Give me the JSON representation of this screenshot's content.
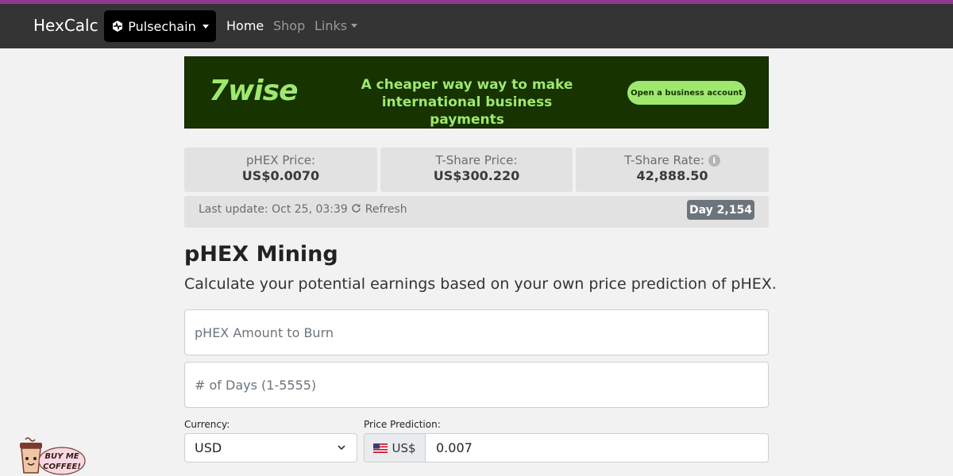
{
  "navbar": {
    "brand": "HexCalc",
    "chain_label": "Pulsechain",
    "home": "Home",
    "shop": "Shop",
    "links": "Links"
  },
  "banner": {
    "logo": "7wise",
    "text": "A cheaper way way to make international business payments",
    "cta": "Open a business account"
  },
  "stats": [
    {
      "label": "pHEX Price:",
      "value": "US$0.0070"
    },
    {
      "label": "T-Share Price:",
      "value": "US$300.220"
    },
    {
      "label": "T-Share Rate:",
      "value": "42,888.50"
    }
  ],
  "update": {
    "text": "Last update: Oct 25, 03:39",
    "refresh": "Refresh",
    "day": "Day 2,154"
  },
  "section": {
    "title": "pHEX Mining",
    "subtitle": "Calculate your potential earnings based on your own price prediction of pHEX."
  },
  "form": {
    "amount_placeholder": "pHEX Amount to Burn",
    "days_placeholder": "# of Days (1-5555)",
    "currency_label": "Currency:",
    "currency_value": "USD",
    "price_label": "Price Prediction:",
    "price_prefix": "US$",
    "price_value": "0.007"
  },
  "coffee": {
    "text1": "BUY ME",
    "text2": "COFFEE!"
  },
  "colors": {
    "stripe": "#8e3a8e",
    "navbar": "#343434",
    "banner_bg": "#163300",
    "banner_accent": "#9fe870",
    "badge": "#6c757d"
  }
}
